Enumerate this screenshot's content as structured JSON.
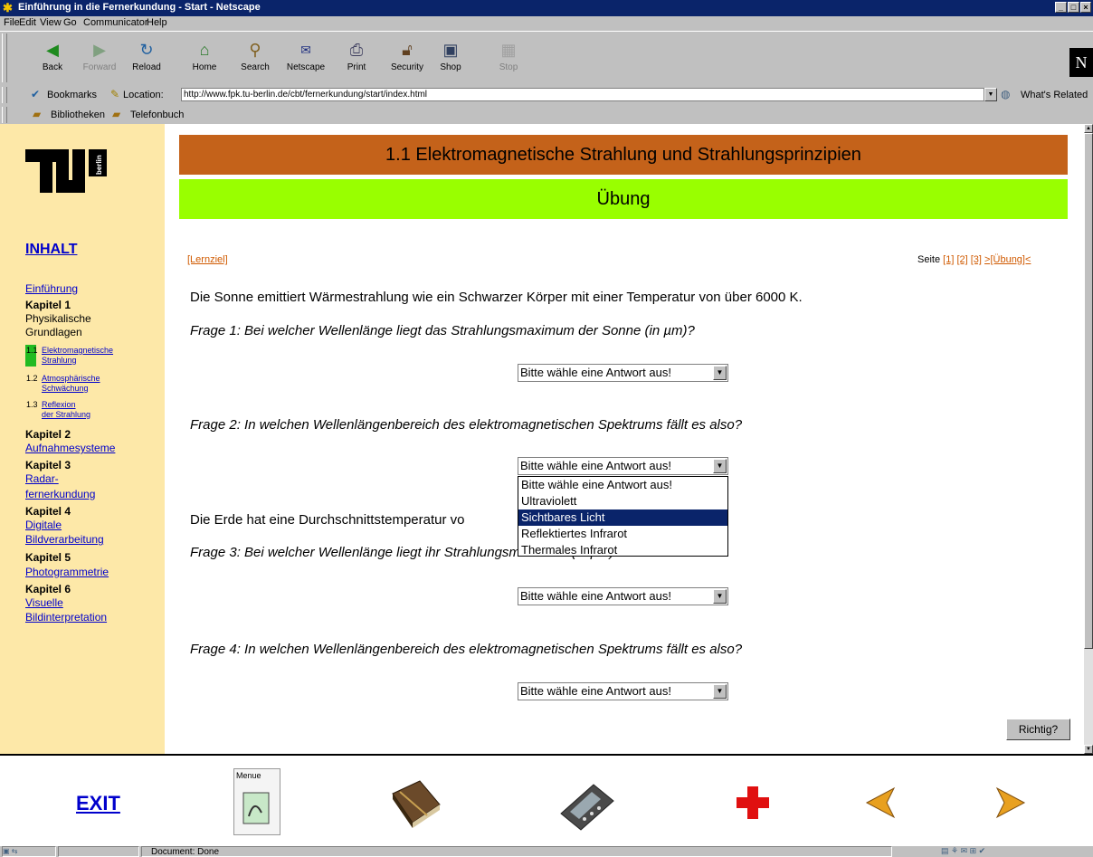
{
  "window": {
    "title": "Einführung in die Fernerkundung - Start - Netscape"
  },
  "menu": [
    "File",
    "Edit",
    "View",
    "Go",
    "Communicator",
    "Help"
  ],
  "toolbar": {
    "buttons": [
      {
        "label": "Back",
        "icon": "back-arrow-icon"
      },
      {
        "label": "Forward",
        "icon": "forward-arrow-icon"
      },
      {
        "label": "Reload",
        "icon": "reload-icon"
      },
      {
        "label": "Home",
        "icon": "home-icon"
      },
      {
        "label": "Search",
        "icon": "search-icon"
      },
      {
        "label": "Netscape",
        "icon": "netscape-icon"
      },
      {
        "label": "Print",
        "icon": "print-icon"
      },
      {
        "label": "Security",
        "icon": "lock-icon"
      },
      {
        "label": "Shop",
        "icon": "shop-icon"
      },
      {
        "label": "Stop",
        "icon": "stop-icon"
      }
    ],
    "logo": "N"
  },
  "location": {
    "bookmarks_label": "Bookmarks",
    "label": "Location:",
    "url": "http://www.fpk.tu-berlin.de/cbt/fernerkundung/start/index.html",
    "related_label": "What's Related"
  },
  "personal": {
    "items": [
      "Bibliotheken",
      "Telefonbuch"
    ]
  },
  "nav": {
    "inhalt": "INHALT",
    "einfuehrung": "Einführung",
    "k1": "Kapitel 1",
    "k1_title_a": "Physikalische",
    "k1_title_b": "Grundlagen",
    "s11_num": "1.1",
    "s11_a": "Elektromagnetische",
    "s11_b": "Strahlung",
    "s12_num": "1.2",
    "s12_a": "Atmosphärische",
    "s12_b": "Schwächung",
    "s13_num": "1.3",
    "s13_a": "Reflexion",
    "s13_b": "der Strahlung",
    "k2": "Kapitel 2",
    "k2_link": "Aufnahmesysteme",
    "k3": "Kapitel 3",
    "k3_link_a": "Radar-",
    "k3_link_b": "fernerkundung",
    "k4": "Kapitel 4",
    "k4_link_a": "Digitale",
    "k4_link_b": "Bildverarbeitung",
    "k5": "Kapitel 5",
    "k5_link": "Photogrammetrie",
    "k6": "Kapitel 6",
    "k6_link_a": "Visuelle",
    "k6_link_b": "Bildinterpretation"
  },
  "main": {
    "header": "1.1 Elektromagnetische Strahlung und Strahlungsprinzipien",
    "subheader": "Übung",
    "lernziel": "[Lernziel]",
    "seite_label": "Seite",
    "pages": [
      "[1]",
      "[2]",
      "[3]",
      ">[Übung]<"
    ],
    "stmt1": "Die Sonne emittiert Wärmestrahlung wie ein Schwarzer Körper mit einer Temperatur von über 6000 K.",
    "q1": "Frage 1: Bei welcher Wellenlänge liegt das Strahlungsmaximum der Sonne (in µm)?",
    "q2": "Frage 2: In welchen Wellenlängenbereich des elektromagnetischen Spektrums fällt es also?",
    "stmt2": "Die Erde hat eine Durchschnittstemperatur vo",
    "q3": "Frage 3: Bei welcher Wellenlänge liegt ihr Str",
    "q3_tail": "ahlungsmaximum (in µm)?",
    "q4": "Frage 4: In welchen Wellenlängenbereich des elektromagnetischen Spektrums fällt es also?",
    "select_placeholder": "Bitte wähle eine Antwort aus!",
    "dropdown_options": [
      "Bitte wähle eine Antwort aus!",
      "Ultraviolett",
      "Sichtbares Licht",
      "Reflektiertes Infrarot",
      "Thermales Infrarot"
    ],
    "dropdown_highlighted": "Sichtbares Licht",
    "check_button": "Richtig?"
  },
  "footer": {
    "exit": "EXIT",
    "menue_label": "Menue"
  },
  "status": {
    "text": "Document: Done"
  },
  "colors": {
    "header_bg": "#c4621a",
    "subheader_bg": "#99ff00",
    "nav_bg": "#fde8a8",
    "titlebar": "#0a246a",
    "link": "#0000cc",
    "orange_link": "#d05a00"
  }
}
